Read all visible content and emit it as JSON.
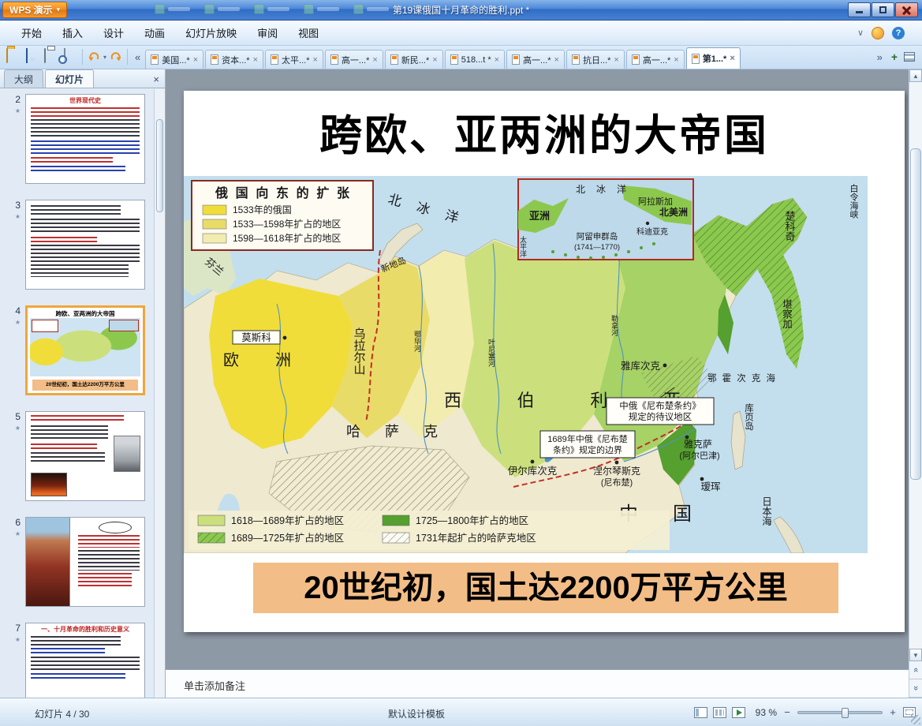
{
  "titlebar": {
    "app_name": "WPS 演示",
    "document_title": "第19课俄国十月革命的胜利.ppt *"
  },
  "menubar": {
    "items": [
      "开始",
      "插入",
      "设计",
      "动画",
      "幻灯片放映",
      "审阅",
      "视图"
    ]
  },
  "doctabs": {
    "tabs": [
      {
        "label": "美国...*"
      },
      {
        "label": "资本...*"
      },
      {
        "label": "太平...*"
      },
      {
        "label": "高一...*"
      },
      {
        "label": "新民...*"
      },
      {
        "label": "518...t *"
      },
      {
        "label": "高一...*"
      },
      {
        "label": "抗日...*"
      },
      {
        "label": "高一...*"
      },
      {
        "label": "第1...*"
      }
    ]
  },
  "glyphs": {
    "close": "×",
    "scroll_left": "«",
    "scroll_right": "»",
    "new_tab": "+",
    "menu_collapse": "∨",
    "help_mark": "?",
    "anim_star": "★",
    "scroll_up": "▲",
    "scroll_down": "▼",
    "zoom_minus": "−",
    "zoom_plus": "+",
    "dropdown_caret": "▾",
    "prev_slide": "«",
    "next_slide": "»"
  },
  "sidebar": {
    "tabs": [
      {
        "label": "大纲"
      },
      {
        "label": "幻灯片"
      }
    ],
    "slides": [
      {
        "number": "2",
        "title": "世界现代史"
      },
      {
        "number": "3"
      },
      {
        "number": "4",
        "title": "跨欧、亚两洲的大帝国",
        "caption": "20世纪初，国土达2200万平方公里"
      },
      {
        "number": "5"
      },
      {
        "number": "6"
      },
      {
        "number": "7",
        "title": "一、十月革命的胜利和历史意义"
      }
    ]
  },
  "slide": {
    "title": "跨欧、亚两洲的大帝国",
    "caption": "20世纪初，国土达2200万平方公里"
  },
  "map": {
    "legend": {
      "title": "俄国向东的扩张",
      "items": [
        "1533年的俄国",
        "1533—1598年扩占的地区",
        "1598—1618年扩占的地区"
      ]
    },
    "bottom_legend": [
      "1618—1689年扩占的地区",
      "1689—1725年扩占的地区",
      "1725—1800年扩占的地区",
      "1731年起扩占的哈萨克地区"
    ],
    "labels": {
      "arctic_ocean": "北冰洋",
      "finland": "芬兰",
      "novaya_zemlya": "新地岛",
      "moscow": "莫斯科",
      "europe": "欧洲",
      "ural_mountains": "乌拉尔山",
      "siberia": "西伯利亚",
      "kazakh": "哈萨克",
      "yakutsk": "雅库次克",
      "irkutsk": "伊尔库次克",
      "nerchinsk": "涅尔琴斯克",
      "nerchinsk_alt": "(尼布楚)",
      "yaksa": "雅克萨",
      "yaksa_alt": "(阿尔巴津)",
      "aihui": "瑷珲",
      "china": "中国",
      "sakhalin": "库页岛",
      "chukchi": "楚科奇",
      "kamchatka": "堪察加",
      "okhotsk_sea": "鄂霍次克海",
      "japan_sea": "日本海",
      "bering_strait": "白令海峡",
      "ob_river": "鄂毕河",
      "yenisei_river": "叶尼塞河",
      "lena_river": "勒拿河",
      "treaty_area_line1": "中俄《尼布楚条约》",
      "treaty_area_line2": "规定的待议地区",
      "treaty_border_line1": "1689年中俄《尼布楚",
      "treaty_border_line2": "条约》规定的边界"
    },
    "inset": {
      "arctic_ocean": "北冰洋",
      "asia": "亚洲",
      "alaska": "阿拉斯加",
      "north_america": "北美洲",
      "kodiak": "科迪亚克",
      "aleutian_islands": "阿留申群岛",
      "aleutian_years": "(1741—1770)",
      "pacific": "太平洋"
    },
    "colors": {
      "sea": "#c3dfee",
      "c1533": "#f0dd3a",
      "c1533_1598": "#e9db68",
      "c1598_1618": "#f2ecae",
      "c1618_1689": "#cbe07c",
      "c1689_1725": "#8cc84e",
      "c1725_1800": "#55a02e"
    }
  },
  "notes": {
    "placeholder": "单击添加备注"
  },
  "statusbar": {
    "slide_indicator": "幻灯片 4 / 30",
    "template_name": "默认设计模板",
    "zoom_level": "93 %"
  },
  "ui_colors": {
    "caption_bg": "#f2bd86",
    "thumb_selected_border": "#f0a63c",
    "wps_orange": "#f08a1e"
  }
}
